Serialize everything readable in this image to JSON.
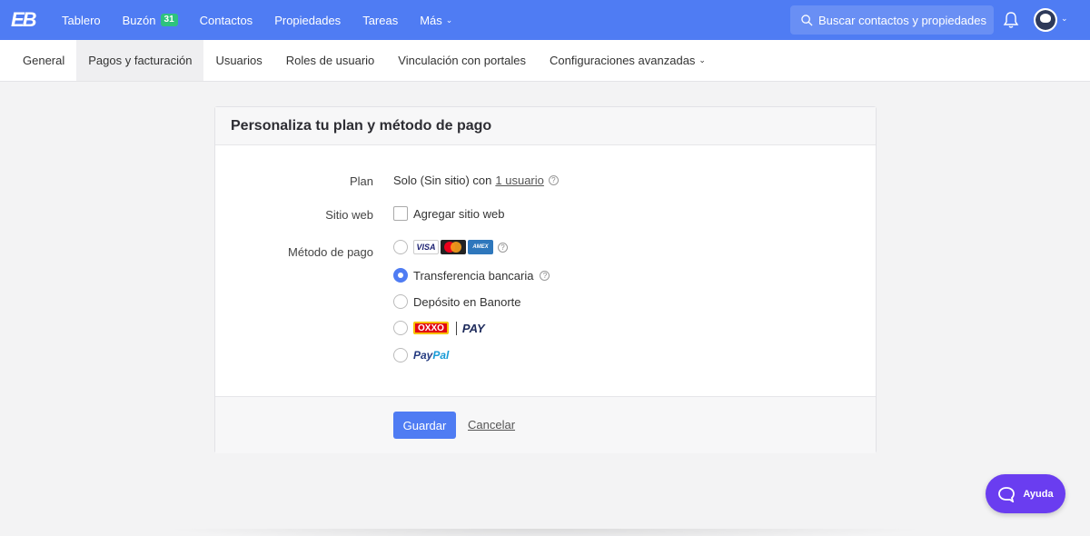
{
  "topbar": {
    "logo_text": "EB",
    "nav": [
      {
        "label": "Tablero"
      },
      {
        "label": "Buzón",
        "badge": "31"
      },
      {
        "label": "Contactos"
      },
      {
        "label": "Propiedades"
      },
      {
        "label": "Tareas"
      },
      {
        "label": "Más"
      }
    ],
    "search_placeholder": "Buscar contactos y propiedades"
  },
  "subtabs": [
    {
      "label": "General"
    },
    {
      "label": "Pagos y facturación",
      "active": true
    },
    {
      "label": "Usuarios"
    },
    {
      "label": "Roles de usuario"
    },
    {
      "label": "Vinculación con portales"
    },
    {
      "label": "Configuraciones avanzadas"
    }
  ],
  "card": {
    "title": "Personaliza tu plan y método de pago",
    "plan": {
      "label": "Plan",
      "text": "Solo (Sin sitio) con",
      "link": "1 usuario"
    },
    "website": {
      "label": "Sitio web",
      "checkbox_label": "Agregar sitio web"
    },
    "payment": {
      "label": "Método de pago",
      "options": [
        {
          "id": "cards",
          "label": ""
        },
        {
          "id": "transfer",
          "label": "Transferencia bancaria",
          "selected": true
        },
        {
          "id": "banorte",
          "label": "Depósito en Banorte"
        },
        {
          "id": "oxxo",
          "label": ""
        },
        {
          "id": "paypal",
          "label": ""
        }
      ],
      "card_logos": {
        "visa": "VISA",
        "amex": "AMEX"
      },
      "oxxo_logo": "OXXO",
      "oxxo_pay": "PAY",
      "paypal_logo_a": "Pay",
      "paypal_logo_b": "Pal"
    },
    "save_label": "Guardar",
    "cancel_label": "Cancelar"
  },
  "help_button": {
    "label": "Ayuda"
  },
  "colors": {
    "primary": "#4f7cf3",
    "help": "#6a3df0",
    "badge": "#2ec27e"
  }
}
